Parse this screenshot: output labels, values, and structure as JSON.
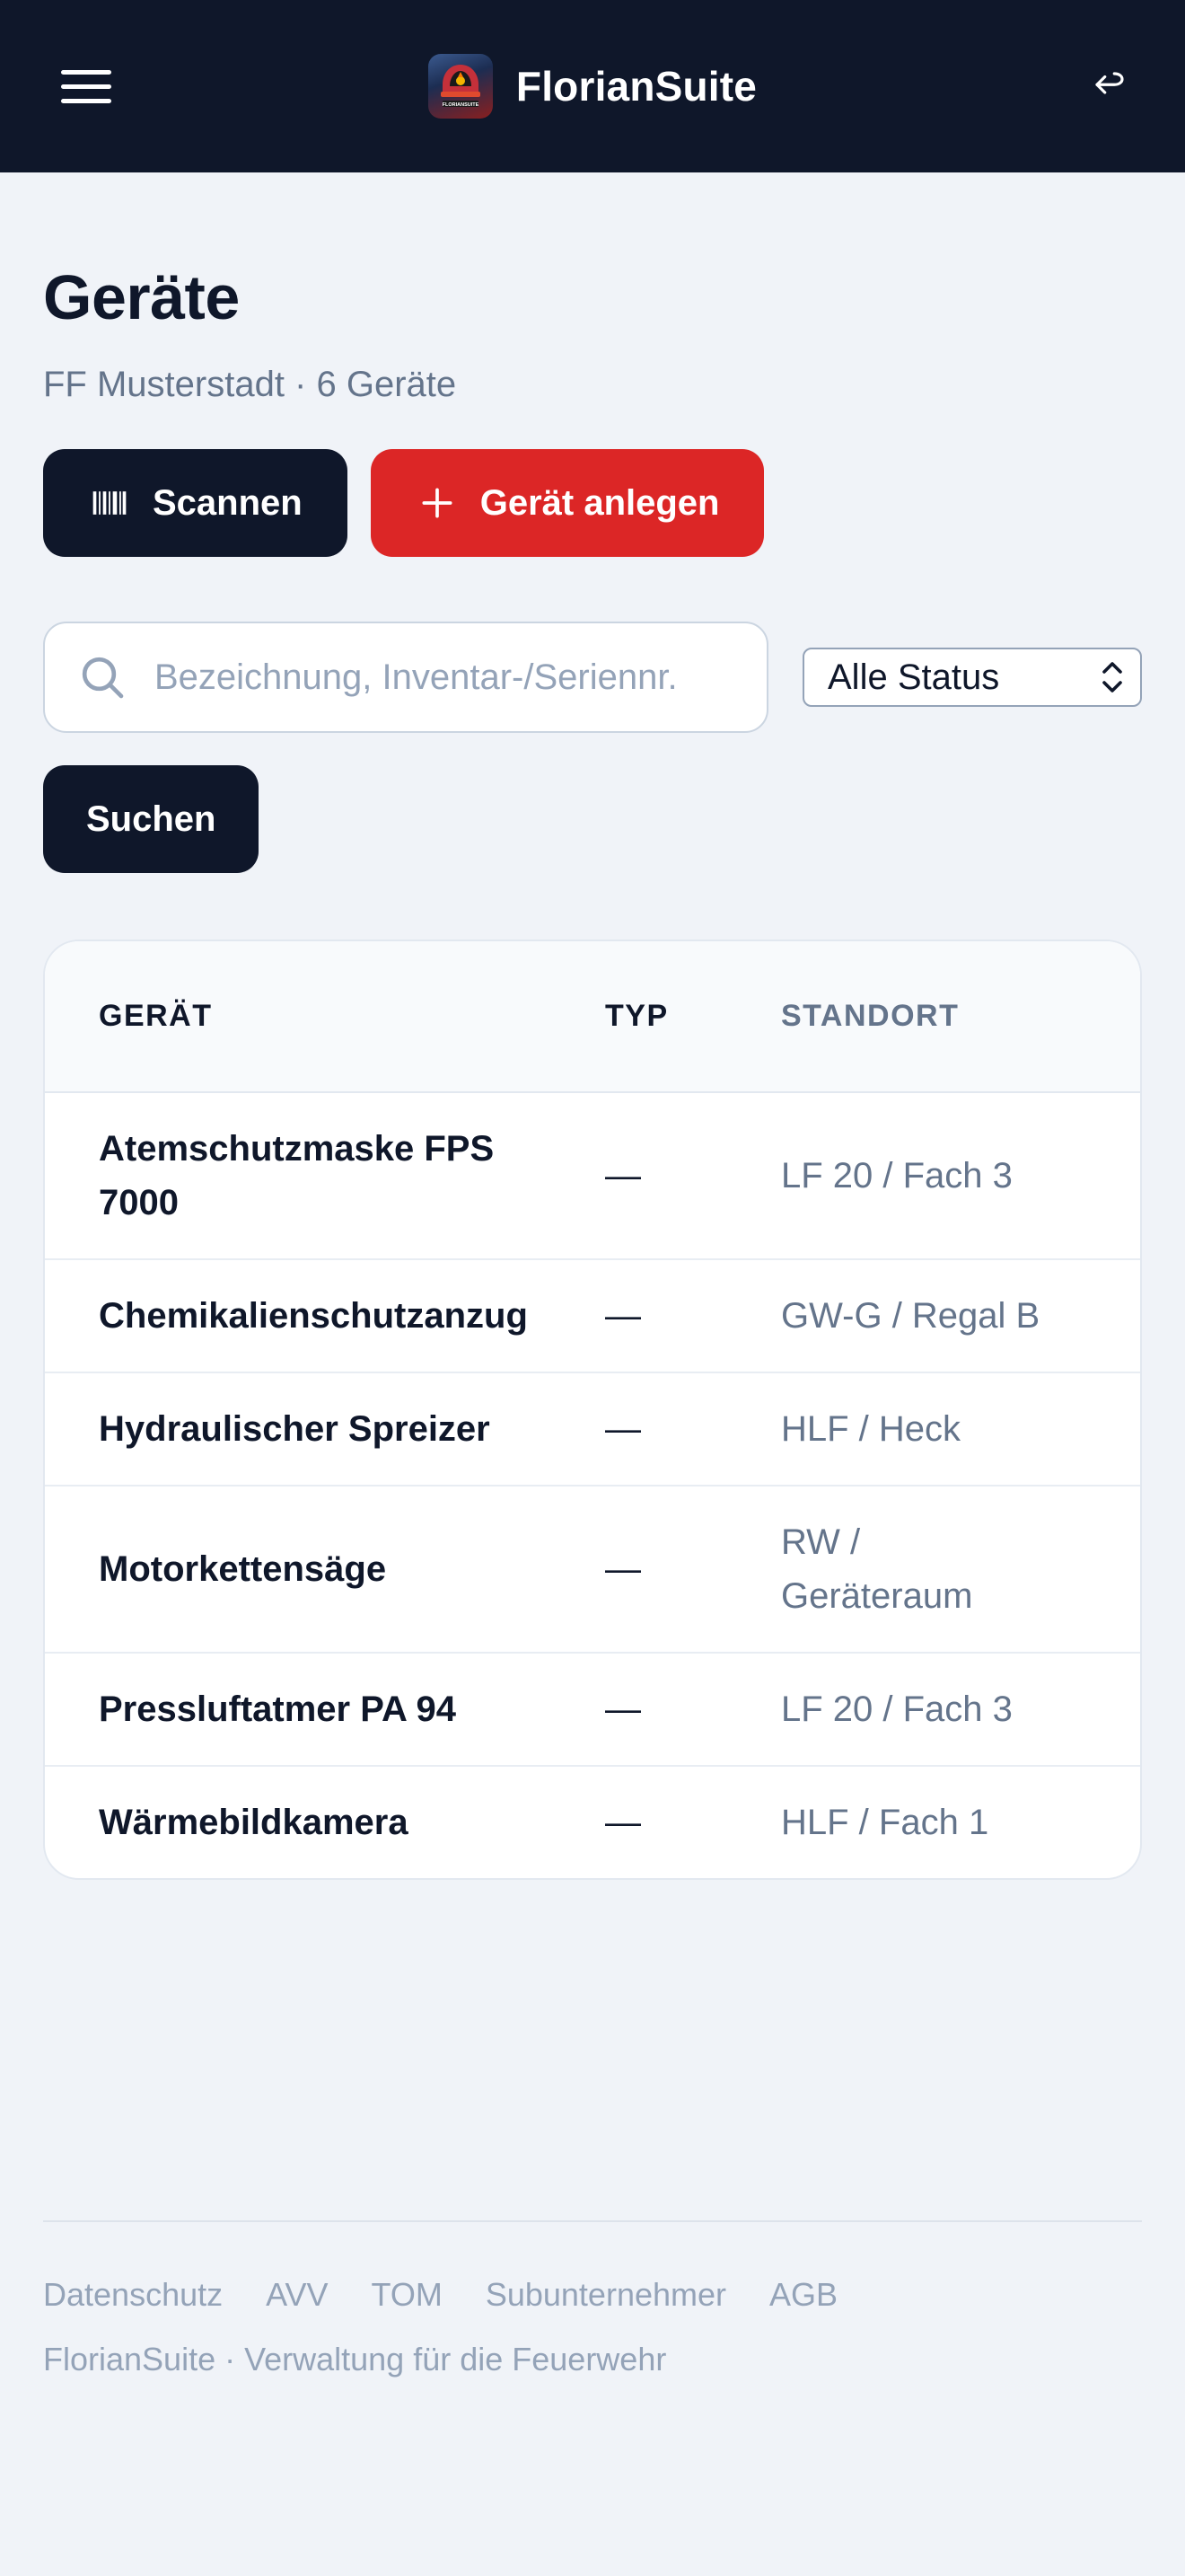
{
  "header": {
    "brand_name": "FlorianSuite",
    "logo_text": "FLORIANSUITE"
  },
  "page": {
    "title": "Geräte",
    "subtitle": "FF Musterstadt · 6 Geräte"
  },
  "actions": {
    "scan_label": "Scannen",
    "add_label": "Gerät anlegen"
  },
  "filters": {
    "search_placeholder": "Bezeichnung, Inventar-/Seriennr.",
    "status_selected": "Alle Status",
    "search_button": "Suchen"
  },
  "table": {
    "headers": {
      "name": "GERÄT",
      "typ": "TYP",
      "standort": "STANDORT"
    },
    "rows": [
      {
        "name": "Atemschutzmaske FPS 7000",
        "typ": "—",
        "standort": "LF 20 / Fach 3"
      },
      {
        "name": "Chemikalienschutzanzug",
        "typ": "—",
        "standort": "GW-G / Regal B"
      },
      {
        "name": "Hydraulischer Spreizer",
        "typ": "—",
        "standort": "HLF / Heck"
      },
      {
        "name": "Motorkettensäge",
        "typ": "—",
        "standort": "RW / Geräteraum"
      },
      {
        "name": "Pressluftatmer PA 94",
        "typ": "—",
        "standort": "LF 20 / Fach 3"
      },
      {
        "name": "Wärmebildkamera",
        "typ": "—",
        "standort": "HLF / Fach 1"
      }
    ]
  },
  "footer": {
    "links": [
      "Datenschutz",
      "AVV",
      "TOM",
      "Subunternehmer",
      "AGB"
    ],
    "tagline": "FlorianSuite · Verwaltung für die Feuerwehr"
  },
  "colors": {
    "header_bg": "#0f172a",
    "primary_dark": "#0f172a",
    "accent_red": "#dc2626",
    "page_bg": "#f0f3f8"
  },
  "icons": {
    "menu": "hamburger-menu-icon",
    "logo": "fire-helmet-logo",
    "return": "return-arrow-icon",
    "scan": "barcode-icon",
    "add": "plus-icon",
    "search": "magnifier-icon",
    "select": "chevron-up-down-icon"
  }
}
